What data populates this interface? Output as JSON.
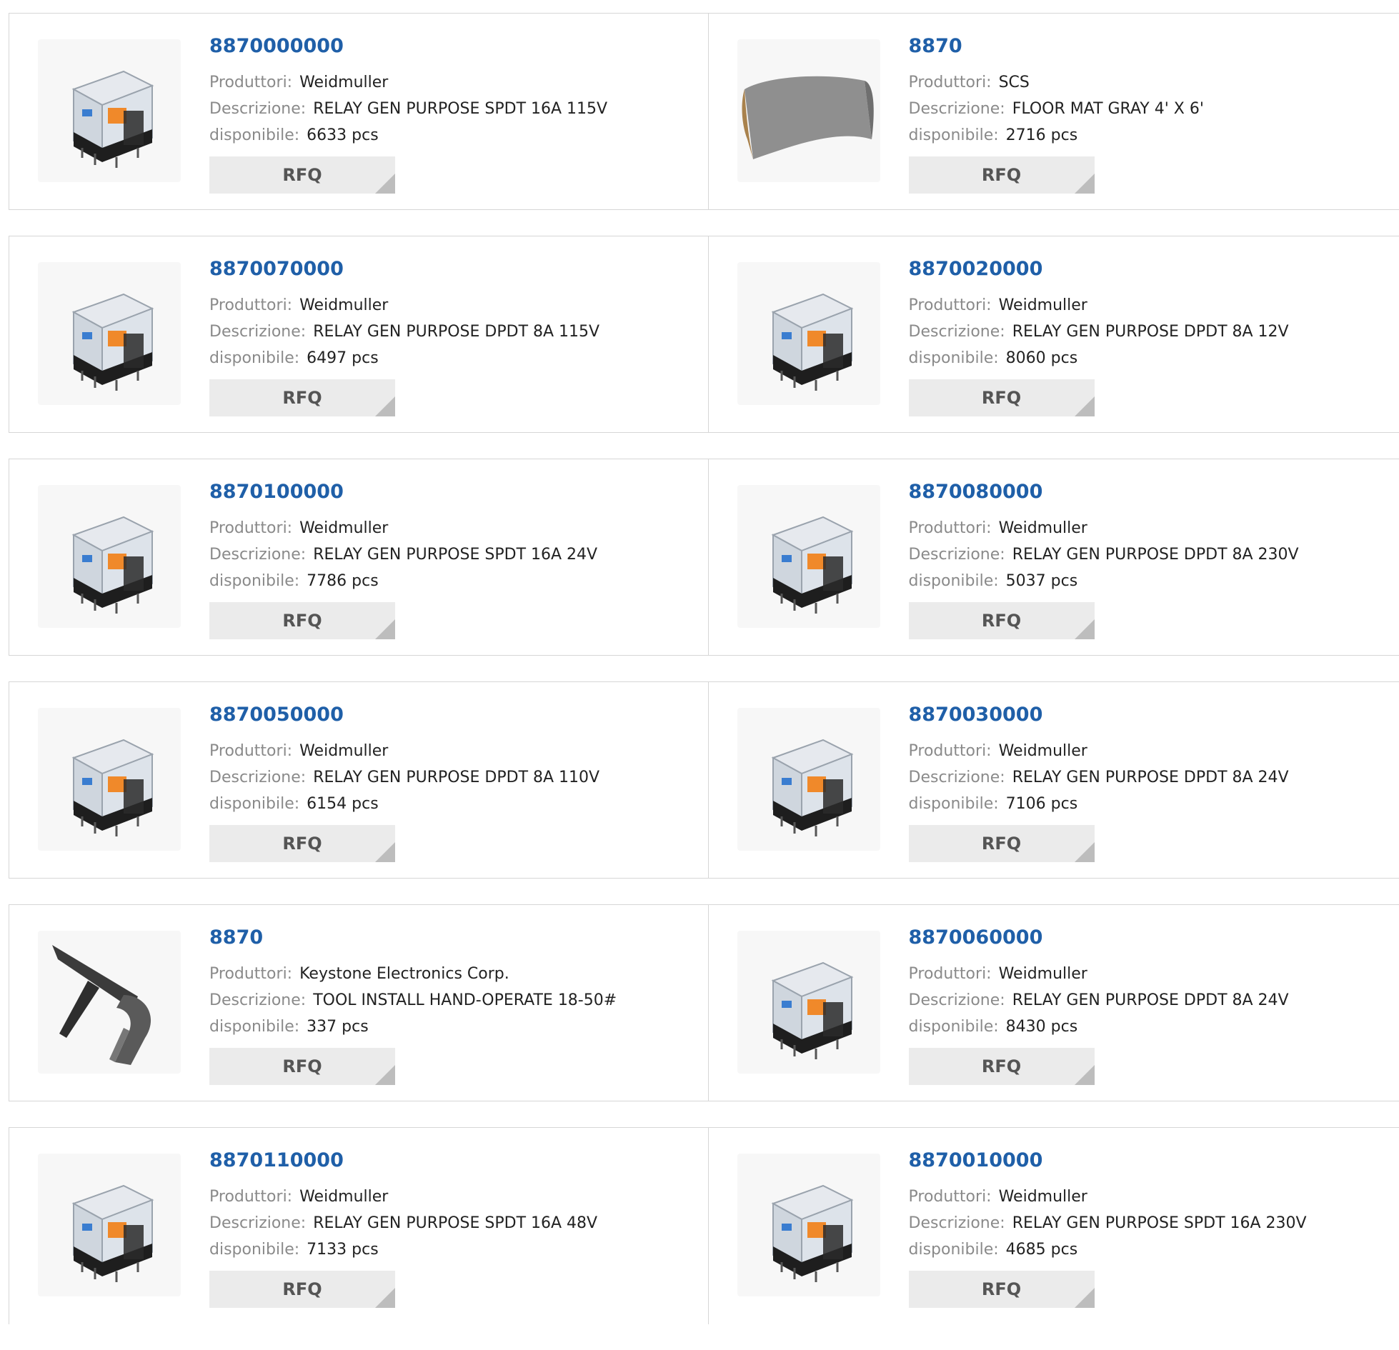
{
  "labels": {
    "manufacturer": "Produttori:",
    "description": "Descrizione:",
    "available": "disponibile:",
    "rfq": "RFQ"
  },
  "colors": {
    "part_link": "#1f5fa8",
    "label_gray": "#8a8a8a",
    "button_bg": "#ebebeb",
    "border": "#d6d6d6"
  },
  "products": [
    {
      "part": "8870000000",
      "manufacturer": "Weidmuller",
      "description": "RELAY GEN PURPOSE SPDT 16A 115V",
      "available": "6633 pcs",
      "image": "relay-image"
    },
    {
      "part": "8870",
      "manufacturer": "SCS",
      "description": "FLOOR MAT GRAY 4' X 6'",
      "available": "2716 pcs",
      "image": "floor-mat-image"
    },
    {
      "part": "8870070000",
      "manufacturer": "Weidmuller",
      "description": "RELAY GEN PURPOSE DPDT 8A 115V",
      "available": "6497 pcs",
      "image": "relay-image"
    },
    {
      "part": "8870020000",
      "manufacturer": "Weidmuller",
      "description": "RELAY GEN PURPOSE DPDT 8A 12V",
      "available": "8060 pcs",
      "image": "relay-image"
    },
    {
      "part": "8870100000",
      "manufacturer": "Weidmuller",
      "description": "RELAY GEN PURPOSE SPDT 16A 24V",
      "available": "7786 pcs",
      "image": "relay-image"
    },
    {
      "part": "8870080000",
      "manufacturer": "Weidmuller",
      "description": "RELAY GEN PURPOSE DPDT 8A 230V",
      "available": "5037 pcs",
      "image": "relay-image"
    },
    {
      "part": "8870050000",
      "manufacturer": "Weidmuller",
      "description": "RELAY GEN PURPOSE DPDT 8A 110V",
      "available": "6154 pcs",
      "image": "relay-image"
    },
    {
      "part": "8870030000",
      "manufacturer": "Weidmuller",
      "description": "RELAY GEN PURPOSE DPDT 8A 24V",
      "available": "7106 pcs",
      "image": "relay-image"
    },
    {
      "part": "8870",
      "manufacturer": "Keystone Electronics Corp.",
      "description": "TOOL INSTALL HAND-OPERATE 18-50#",
      "available": "337 pcs",
      "image": "hand-tool-image"
    },
    {
      "part": "8870060000",
      "manufacturer": "Weidmuller",
      "description": "RELAY GEN PURPOSE DPDT 8A 24V",
      "available": "8430 pcs",
      "image": "relay-image"
    },
    {
      "part": "8870110000",
      "manufacturer": "Weidmuller",
      "description": "RELAY GEN PURPOSE SPDT 16A 48V",
      "available": "7133 pcs",
      "image": "relay-image"
    },
    {
      "part": "8870010000",
      "manufacturer": "Weidmuller",
      "description": "RELAY GEN PURPOSE SPDT 16A 230V",
      "available": "4685 pcs",
      "image": "relay-image"
    }
  ]
}
